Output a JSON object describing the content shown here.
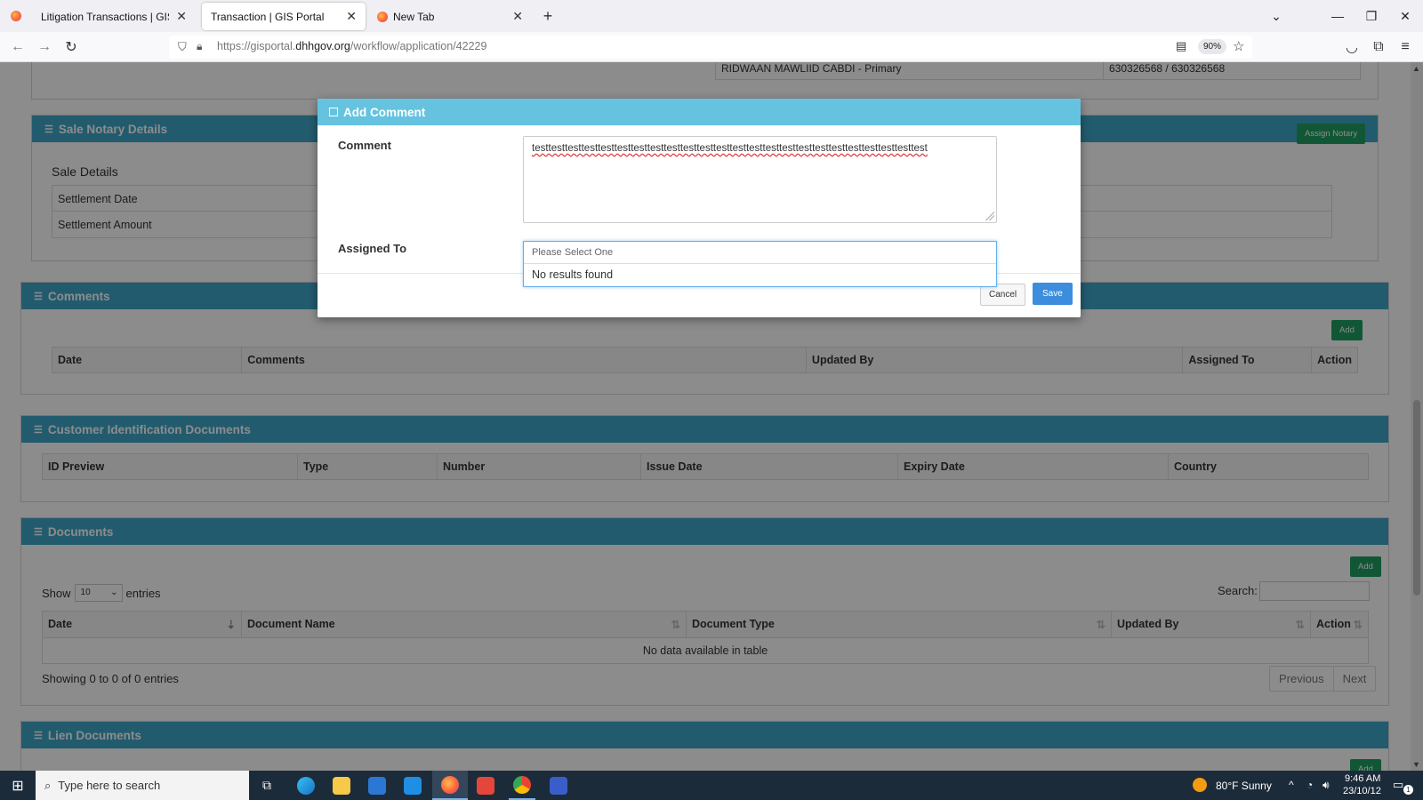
{
  "browser": {
    "tabs": [
      {
        "label": "Litigation Transactions | GIS Portal",
        "active": false
      },
      {
        "label": "Transaction | GIS Portal",
        "active": true
      },
      {
        "label": "New Tab",
        "active": false
      }
    ],
    "new_tab_symbol": "+",
    "url_prefix": "https://gisportal.",
    "url_domain": "dhhgov.org",
    "url_path": "/workflow/application/42229",
    "zoom": "90%"
  },
  "background": {
    "top_row": {
      "name": "RIDWAAN MAWLIID CABDI - Primary",
      "phone": "630326568 / 630326568"
    },
    "sale_notary": {
      "title": "Sale Notary Details",
      "assign_button": "Assign Notary",
      "subtitle": "Sale Details",
      "rows": [
        "Settlement Date",
        "Settlement Amount"
      ]
    },
    "comments": {
      "title": "Comments",
      "add_button": "Add",
      "columns": [
        "Date",
        "Comments",
        "Updated By",
        "Assigned To",
        "Action"
      ]
    },
    "customer_docs": {
      "title": "Customer Identification Documents",
      "columns": [
        "ID Preview",
        "Type",
        "Number",
        "Issue Date",
        "Expiry Date",
        "Country"
      ]
    },
    "documents": {
      "title": "Documents",
      "add_button": "Add",
      "show_label": "Show",
      "entries_value": "10",
      "entries_label": "entries",
      "search_label": "Search:",
      "columns": [
        "Date",
        "Document Name",
        "Document Type",
        "Updated By",
        "Action"
      ],
      "empty_message": "No data available in table",
      "showing_text": "Showing 0 to 0 of 0 entries",
      "prev_label": "Previous",
      "next_label": "Next"
    },
    "lien_docs": {
      "title": "Lien Documents",
      "add_button": "Add"
    }
  },
  "modal": {
    "title": "Add Comment",
    "comment_label": "Comment",
    "comment_value": "testtesttesttesttesttesttesttesttesttesttesttesttesttesttesttesttesttesttesttesttesttesttesttest",
    "assigned_label": "Assigned To",
    "select_placeholder": "Please Select One",
    "no_results": "No results found",
    "cancel_label": "Cancel",
    "save_label": "Save"
  },
  "taskbar": {
    "search_placeholder": "Type here to search",
    "weather": "80°F  Sunny",
    "time": "9:46 AM",
    "date": "23/10/12",
    "notification_count": "1"
  },
  "colors": {
    "panel_header": "#3ea7c8",
    "modal_header": "#66c3df",
    "green_button": "#1f9e63",
    "save_button": "#3c8dde"
  }
}
